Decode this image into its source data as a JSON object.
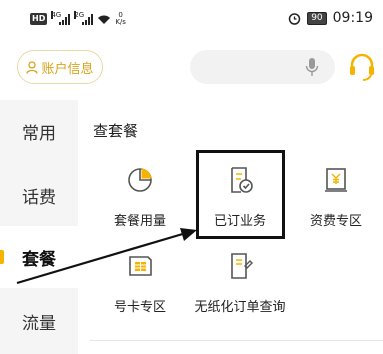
{
  "status_bar": {
    "hd_badge": "HD",
    "net1": "4G",
    "net2": "2G",
    "speed_value": "0",
    "speed_unit": "K/s",
    "battery": "90",
    "time": "09:19"
  },
  "header": {
    "account_label": "账户信息"
  },
  "sidebar": {
    "items": [
      {
        "label": "常用"
      },
      {
        "label": "话费"
      },
      {
        "label": "套餐"
      },
      {
        "label": "流量"
      }
    ],
    "active_index": 2
  },
  "main": {
    "section_title": "查套餐",
    "tiles": [
      {
        "label": "套餐用量",
        "icon": "pie-chart-icon"
      },
      {
        "label": "已订业务",
        "icon": "order-check-icon"
      },
      {
        "label": "资费专区",
        "icon": "yuan-document-icon"
      },
      {
        "label": "号卡专区",
        "icon": "sim-card-icon"
      },
      {
        "label": "无纸化订单查询",
        "icon": "paperless-order-icon"
      }
    ]
  },
  "colors": {
    "accent": "#f5b400",
    "account_text": "#d9a21b",
    "annotation": "#111111"
  }
}
